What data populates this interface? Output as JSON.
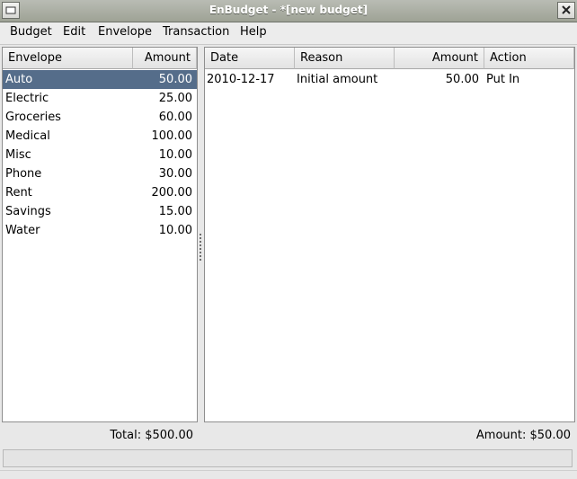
{
  "window": {
    "title": "EnBudget - *[new budget]"
  },
  "menubar": {
    "items": [
      "Budget",
      "Edit",
      "Envelope",
      "Transaction",
      "Help"
    ]
  },
  "envelopes": {
    "columns": [
      "Envelope",
      "Amount"
    ],
    "rows": [
      {
        "name": "Auto",
        "amount": "50.00"
      },
      {
        "name": "Electric",
        "amount": "25.00"
      },
      {
        "name": "Groceries",
        "amount": "60.00"
      },
      {
        "name": "Medical",
        "amount": "100.00"
      },
      {
        "name": "Misc",
        "amount": "10.00"
      },
      {
        "name": "Phone",
        "amount": "30.00"
      },
      {
        "name": "Rent",
        "amount": "200.00"
      },
      {
        "name": "Savings",
        "amount": "15.00"
      },
      {
        "name": "Water",
        "amount": "10.00"
      }
    ],
    "selected_index": 0,
    "total": "Total: $500.00"
  },
  "transactions": {
    "columns": [
      "Date",
      "Reason",
      "Amount",
      "Action"
    ],
    "rows": [
      {
        "date": "2010-12-17",
        "reason": "Initial amount",
        "amount": "50.00",
        "action": "Put In"
      }
    ],
    "amount_summary": "Amount: $50.00"
  },
  "colors": {
    "selection": "#556d8a"
  }
}
